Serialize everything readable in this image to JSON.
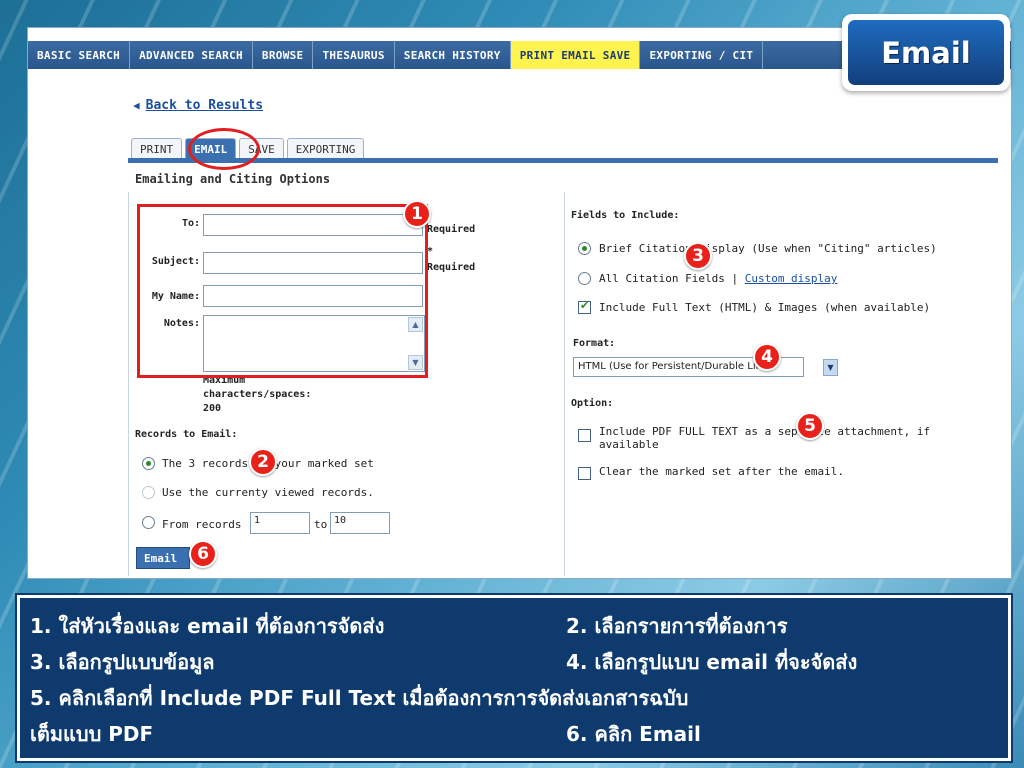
{
  "nav": {
    "tabs": [
      "BASIC SEARCH",
      "ADVANCED SEARCH",
      "BROWSE",
      "THESAURUS",
      "SEARCH HISTORY",
      "PRINT EMAIL SAVE",
      "EXPORTING / CIT"
    ],
    "active_index": 5
  },
  "badge": {
    "title": "Email"
  },
  "back_link": "Back to Results",
  "sub_tabs": [
    "PRINT",
    "EMAIL",
    "SAVE",
    "EXPORTING"
  ],
  "section_title": "Emailing and Citing Options",
  "form": {
    "to_label": "To:",
    "subject_label": "Subject:",
    "name_label": "My Name:",
    "notes_label": "Notes:",
    "required_1": "Required",
    "required_2": "Required",
    "required_star": "*",
    "max_chars": [
      "Maximum",
      "characters/spaces:",
      "200"
    ]
  },
  "records": {
    "heading": "Records to Email:",
    "opt_marked": "The 3 records in your marked set",
    "opt_viewed": "Use the currenty viewed records.",
    "opt_from": "From records",
    "from_value": "1",
    "to_label": "to",
    "to_value": "10"
  },
  "fields": {
    "heading": "Fields to Include:",
    "opt_brief": "Brief Citation display (Use when \"Citing\" articles)",
    "opt_all": "All Citation Fields | ",
    "custom_link": "Custom display",
    "opt_fulltext": "Include Full Text (HTML) & Images (when available)"
  },
  "format": {
    "heading": "Format:",
    "selected": "HTML (Use for Persistent/Durable Link)"
  },
  "option": {
    "heading": "Option:",
    "pdf_line1": "Include PDF FULL TEXT as a separate attachment, if",
    "pdf_line2": "available",
    "clear": "Clear the marked set after the email."
  },
  "email_button": "Email",
  "steps": [
    "1",
    "2",
    "3",
    "4",
    "5",
    "6"
  ],
  "captions": {
    "c1": "1. ใส่หัวเรื่องและ email ที่ต้องการจัดส่ง",
    "c2": "2. เลือกรายการที่ต้องการ",
    "c3": "3. เลือกรูปแบบข้อมูล",
    "c4": "4. เลือกรูปแบบ email ที่จะจัดส่ง",
    "c5": "5. คลิกเลือกที่ Include PDF Full Text เมื่อต้องการการจัดส่งเอกสารฉบับ",
    "c5b": "เต็มแบบ PDF",
    "c6": "6. คลิก Email"
  },
  "colors": {
    "nav_bg": "#2a568c",
    "nav_active": "#fff44f",
    "accent": "#3a6fb0",
    "highlight": "#e02020",
    "caption_bg": "#0e3a6e"
  }
}
